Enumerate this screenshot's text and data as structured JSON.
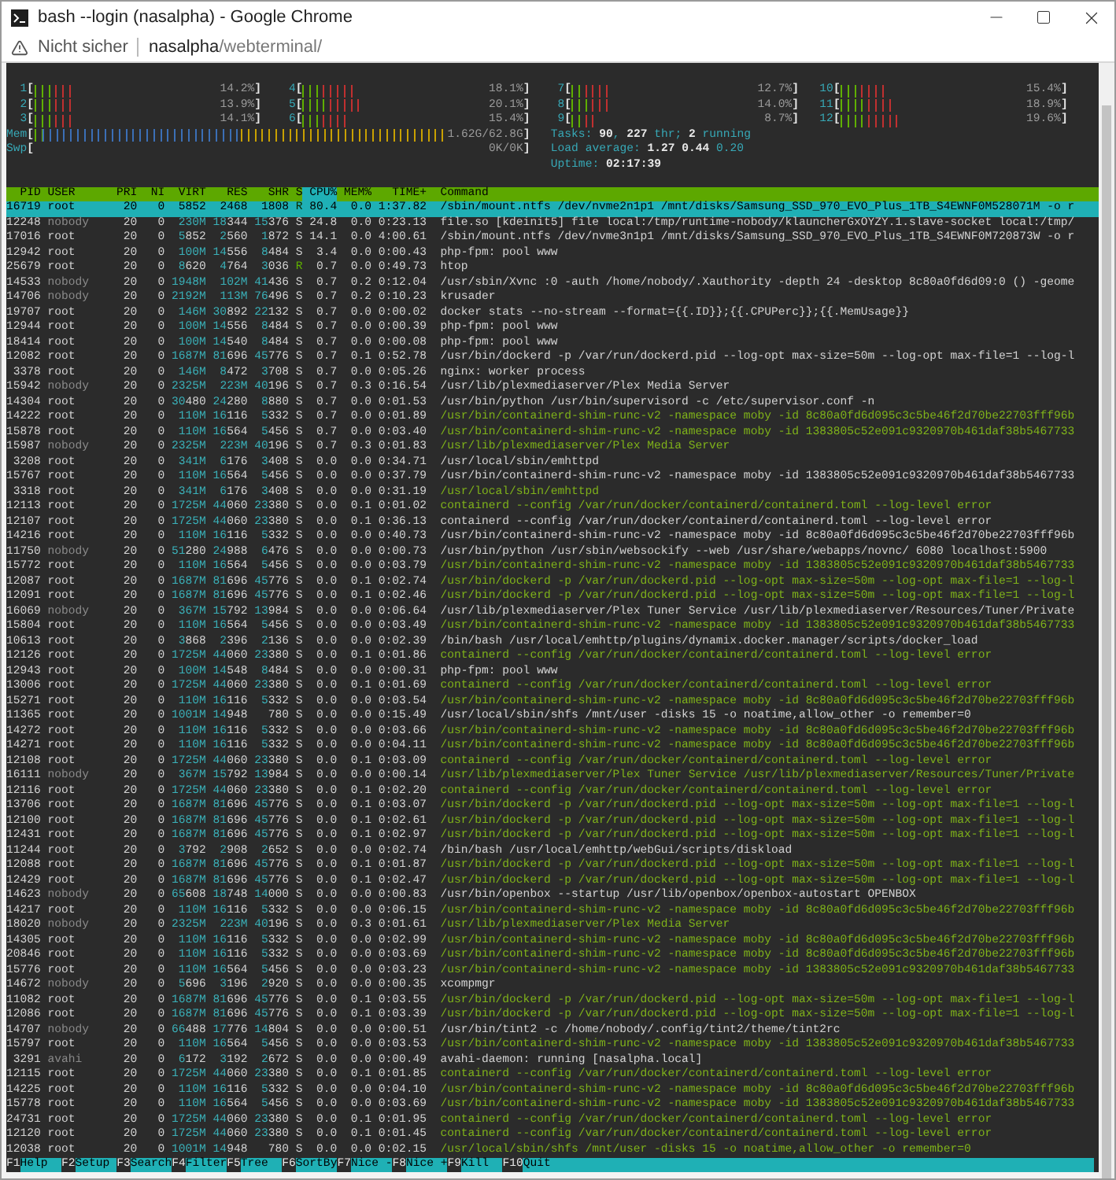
{
  "window": {
    "title": "bash --login (nasalpha) - Google Chrome"
  },
  "address_bar": {
    "security": "Nicht sicher",
    "host": "nasalpha",
    "path": "/webterminal/"
  },
  "meters": {
    "cpus": [
      {
        "label": "1",
        "open": "[",
        "reading": "14.2%",
        "close": "]"
      },
      {
        "label": "4",
        "open": "[",
        "reading": "18.1%",
        "close": "]"
      },
      {
        "label": "7",
        "open": "[",
        "reading": "12.7%",
        "close": "]"
      },
      {
        "label": "10",
        "open": "[",
        "reading": "15.4%",
        "close": "]"
      },
      {
        "label": "2",
        "open": "[",
        "reading": "13.9%",
        "close": "]"
      },
      {
        "label": "5",
        "open": "[",
        "reading": "20.1%",
        "close": "]"
      },
      {
        "label": "8",
        "open": "[",
        "reading": "14.0%",
        "close": "]"
      },
      {
        "label": "11",
        "open": "[",
        "reading": "18.9%",
        "close": "]"
      },
      {
        "label": "3",
        "open": "[",
        "reading": "14.1%",
        "close": "]"
      },
      {
        "label": "6",
        "open": "[",
        "reading": "15.4%",
        "close": "]"
      },
      {
        "label": "9",
        "open": "[",
        "reading": "8.7%",
        "close": "]"
      },
      {
        "label": "12",
        "open": "[",
        "reading": "19.6%",
        "close": "]"
      }
    ],
    "memory": [
      {
        "label": "Mem",
        "open": "[",
        "reading": "1.62G/62.8G",
        "close": "]",
        "filled": true
      },
      {
        "label": "Swp",
        "open": "[",
        "reading": "0K/0K",
        "close": "]",
        "filled": false
      }
    ],
    "info": [
      "Tasks: **90**, **227** thr; **2** running",
      "Load average: **1.27** **0.44** 0.20",
      "Uptime: **02:17:39**"
    ]
  },
  "table": {
    "columns": [
      {
        "label": "PID",
        "selected": false
      },
      {
        "label": "USER",
        "selected": false
      },
      {
        "label": "PRI",
        "selected": false
      },
      {
        "label": "NI",
        "selected": false
      },
      {
        "label": "VIRT",
        "selected": false
      },
      {
        "label": "RES",
        "selected": false
      },
      {
        "label": "SHR",
        "selected": false
      },
      {
        "label": "S",
        "selected": false
      },
      {
        "label": "CPU%",
        "selected": true
      },
      {
        "label": "MEM%",
        "selected": false
      },
      {
        "label": "TIME+",
        "selected": false
      },
      {
        "label": "Command",
        "selected": false
      }
    ],
    "rows": [
      {
        "pid": "16719",
        "user": "root",
        "pri": "20",
        "ni": "0",
        "virt": "5852",
        "res": "2468",
        "shr": "1808",
        "state": "R",
        "cpu": "80.4",
        "mem": "0.0",
        "time": "1:37.82",
        "command": "/sbin/mount.ntfs /dev/nvme2n1p1 /mnt/disks/Samsung_SSD_970_EVO_Plus_1TB_S4EWNF0M528071M -o r",
        "selected": true,
        "user_dimmed": false,
        "running": true,
        "thread": false
      },
      {
        "pid": "12248",
        "user": "nobody",
        "pri": "20",
        "ni": "0",
        "virt": "230M",
        "res": "18344",
        "shr": "15376",
        "state": "S",
        "cpu": "24.8",
        "mem": "0.0",
        "time": "0:23.13",
        "command": "file.so [kdeinit5] file local:/tmp/runtime-nobody/klauncherGxOYZY.1.slave-socket local:/tmp/",
        "selected": false,
        "user_dimmed": true,
        "running": false,
        "thread": false
      },
      {
        "pid": "17016",
        "user": "root",
        "pri": "20",
        "ni": "0",
        "virt": "5852",
        "res": "2560",
        "shr": "1872",
        "state": "S",
        "cpu": "14.1",
        "mem": "0.0",
        "time": "4:00.61",
        "command": "/sbin/mount.ntfs /dev/nvme3n1p1 /mnt/disks/Samsung_SSD_970_EVO_Plus_1TB_S4EWNF0M720873W -o r",
        "selected": false,
        "user_dimmed": false,
        "running": false,
        "thread": false
      },
      {
        "pid": "12942",
        "user": "root",
        "pri": "20",
        "ni": "0",
        "virt": "100M",
        "res": "14556",
        "shr": "8484",
        "state": "S",
        "cpu": "3.4",
        "mem": "0.0",
        "time": "0:00.43",
        "command": "php-fpm: pool www",
        "selected": false,
        "user_dimmed": false,
        "running": false,
        "thread": false
      },
      {
        "pid": "25679",
        "user": "root",
        "pri": "20",
        "ni": "0",
        "virt": "8620",
        "res": "4764",
        "shr": "3036",
        "state": "R",
        "cpu": "0.7",
        "mem": "0.0",
        "time": "0:49.73",
        "command": "htop",
        "selected": false,
        "user_dimmed": false,
        "running": true,
        "thread": false
      },
      {
        "pid": "14533",
        "user": "nobody",
        "pri": "20",
        "ni": "0",
        "virt": "1948M",
        "res": "102M",
        "shr": "41436",
        "state": "S",
        "cpu": "0.7",
        "mem": "0.2",
        "time": "0:12.04",
        "command": "/usr/sbin/Xvnc :0 -auth /home/nobody/.Xauthority -depth 24 -desktop 8c80a0fd6d09:0 () -geome",
        "selected": false,
        "user_dimmed": true,
        "running": false,
        "thread": false
      },
      {
        "pid": "14706",
        "user": "nobody",
        "pri": "20",
        "ni": "0",
        "virt": "2192M",
        "res": "113M",
        "shr": "76496",
        "state": "S",
        "cpu": "0.7",
        "mem": "0.2",
        "time": "0:10.23",
        "command": "krusader",
        "selected": false,
        "user_dimmed": true,
        "running": false,
        "thread": false
      },
      {
        "pid": "19707",
        "user": "root",
        "pri": "20",
        "ni": "0",
        "virt": "146M",
        "res": "30892",
        "shr": "22132",
        "state": "S",
        "cpu": "0.7",
        "mem": "0.0",
        "time": "0:00.02",
        "command": "docker stats --no-stream --format={{.ID}};{{.CPUPerc}};{{.MemUsage}}",
        "selected": false,
        "user_dimmed": false,
        "running": false,
        "thread": false
      },
      {
        "pid": "12944",
        "user": "root",
        "pri": "20",
        "ni": "0",
        "virt": "100M",
        "res": "14556",
        "shr": "8484",
        "state": "S",
        "cpu": "0.7",
        "mem": "0.0",
        "time": "0:00.39",
        "command": "php-fpm: pool www",
        "selected": false,
        "user_dimmed": false,
        "running": false,
        "thread": false
      },
      {
        "pid": "18414",
        "user": "root",
        "pri": "20",
        "ni": "0",
        "virt": "100M",
        "res": "14540",
        "shr": "8484",
        "state": "S",
        "cpu": "0.7",
        "mem": "0.0",
        "time": "0:00.08",
        "command": "php-fpm: pool www",
        "selected": false,
        "user_dimmed": false,
        "running": false,
        "thread": false
      },
      {
        "pid": "12082",
        "user": "root",
        "pri": "20",
        "ni": "0",
        "virt": "1687M",
        "res": "81696",
        "shr": "45776",
        "state": "S",
        "cpu": "0.7",
        "mem": "0.1",
        "time": "0:52.78",
        "command": "/usr/bin/dockerd -p /var/run/dockerd.pid --log-opt max-size=50m --log-opt max-file=1 --log-l",
        "selected": false,
        "user_dimmed": false,
        "running": false,
        "thread": false
      },
      {
        "pid": "3378",
        "user": "root",
        "pri": "20",
        "ni": "0",
        "virt": "146M",
        "res": "8472",
        "shr": "3708",
        "state": "S",
        "cpu": "0.7",
        "mem": "0.0",
        "time": "0:05.26",
        "command": "nginx: worker process",
        "selected": false,
        "user_dimmed": false,
        "running": false,
        "thread": false
      },
      {
        "pid": "15942",
        "user": "nobody",
        "pri": "20",
        "ni": "0",
        "virt": "2325M",
        "res": "223M",
        "shr": "40196",
        "state": "S",
        "cpu": "0.7",
        "mem": "0.3",
        "time": "0:16.54",
        "command": "/usr/lib/plexmediaserver/Plex Media Server",
        "selected": false,
        "user_dimmed": true,
        "running": false,
        "thread": false
      },
      {
        "pid": "14304",
        "user": "root",
        "pri": "20",
        "ni": "0",
        "virt": "30480",
        "res": "24280",
        "shr": "8880",
        "state": "S",
        "cpu": "0.7",
        "mem": "0.0",
        "time": "0:01.53",
        "command": "/usr/bin/python /usr/bin/supervisord -c /etc/supervisor.conf -n",
        "selected": false,
        "user_dimmed": false,
        "running": false,
        "thread": false
      },
      {
        "pid": "14222",
        "user": "root",
        "pri": "20",
        "ni": "0",
        "virt": "110M",
        "res": "16116",
        "shr": "5332",
        "state": "S",
        "cpu": "0.7",
        "mem": "0.0",
        "time": "0:01.89",
        "command": "/usr/bin/containerd-shim-runc-v2 -namespace moby -id 8c80a0fd6d095c3c5be46f2d70be22703fff96b",
        "selected": false,
        "user_dimmed": false,
        "running": false,
        "thread": true
      },
      {
        "pid": "15878",
        "user": "root",
        "pri": "20",
        "ni": "0",
        "virt": "110M",
        "res": "16564",
        "shr": "5456",
        "state": "S",
        "cpu": "0.7",
        "mem": "0.0",
        "time": "0:03.40",
        "command": "/usr/bin/containerd-shim-runc-v2 -namespace moby -id 1383805c52e091c9320970b461daf38b5467733",
        "selected": false,
        "user_dimmed": false,
        "running": false,
        "thread": true
      },
      {
        "pid": "15987",
        "user": "nobody",
        "pri": "20",
        "ni": "0",
        "virt": "2325M",
        "res": "223M",
        "shr": "40196",
        "state": "S",
        "cpu": "0.7",
        "mem": "0.3",
        "time": "0:01.83",
        "command": "/usr/lib/plexmediaserver/Plex Media Server",
        "selected": false,
        "user_dimmed": true,
        "running": false,
        "thread": true
      },
      {
        "pid": "3208",
        "user": "root",
        "pri": "20",
        "ni": "0",
        "virt": "341M",
        "res": "6176",
        "shr": "3408",
        "state": "S",
        "cpu": "0.0",
        "mem": "0.0",
        "time": "0:34.71",
        "command": "/usr/local/sbin/emhttpd",
        "selected": false,
        "user_dimmed": false,
        "running": false,
        "thread": false
      },
      {
        "pid": "15767",
        "user": "root",
        "pri": "20",
        "ni": "0",
        "virt": "110M",
        "res": "16564",
        "shr": "5456",
        "state": "S",
        "cpu": "0.0",
        "mem": "0.0",
        "time": "0:37.79",
        "command": "/usr/bin/containerd-shim-runc-v2 -namespace moby -id 1383805c52e091c9320970b461daf38b5467733",
        "selected": false,
        "user_dimmed": false,
        "running": false,
        "thread": false
      },
      {
        "pid": "3318",
        "user": "root",
        "pri": "20",
        "ni": "0",
        "virt": "341M",
        "res": "6176",
        "shr": "3408",
        "state": "S",
        "cpu": "0.0",
        "mem": "0.0",
        "time": "0:31.19",
        "command": "/usr/local/sbin/emhttpd",
        "selected": false,
        "user_dimmed": false,
        "running": false,
        "thread": true
      },
      {
        "pid": "12113",
        "user": "root",
        "pri": "20",
        "ni": "0",
        "virt": "1725M",
        "res": "44060",
        "shr": "23380",
        "state": "S",
        "cpu": "0.0",
        "mem": "0.1",
        "time": "0:01.02",
        "command": "containerd --config /var/run/docker/containerd/containerd.toml --log-level error",
        "selected": false,
        "user_dimmed": false,
        "running": false,
        "thread": true
      },
      {
        "pid": "12107",
        "user": "root",
        "pri": "20",
        "ni": "0",
        "virt": "1725M",
        "res": "44060",
        "shr": "23380",
        "state": "S",
        "cpu": "0.0",
        "mem": "0.1",
        "time": "0:36.13",
        "command": "containerd --config /var/run/docker/containerd/containerd.toml --log-level error",
        "selected": false,
        "user_dimmed": false,
        "running": false,
        "thread": false
      },
      {
        "pid": "14216",
        "user": "root",
        "pri": "20",
        "ni": "0",
        "virt": "110M",
        "res": "16116",
        "shr": "5332",
        "state": "S",
        "cpu": "0.0",
        "mem": "0.0",
        "time": "0:40.73",
        "command": "/usr/bin/containerd-shim-runc-v2 -namespace moby -id 8c80a0fd6d095c3c5be46f2d70be22703fff96b",
        "selected": false,
        "user_dimmed": false,
        "running": false,
        "thread": false
      },
      {
        "pid": "11750",
        "user": "nobody",
        "pri": "20",
        "ni": "0",
        "virt": "51280",
        "res": "24988",
        "shr": "6476",
        "state": "S",
        "cpu": "0.0",
        "mem": "0.0",
        "time": "0:00.73",
        "command": "/usr/bin/python /usr/sbin/websockify --web /usr/share/webapps/novnc/ 6080 localhost:5900",
        "selected": false,
        "user_dimmed": true,
        "running": false,
        "thread": false
      },
      {
        "pid": "15772",
        "user": "root",
        "pri": "20",
        "ni": "0",
        "virt": "110M",
        "res": "16564",
        "shr": "5456",
        "state": "S",
        "cpu": "0.0",
        "mem": "0.0",
        "time": "0:03.79",
        "command": "/usr/bin/containerd-shim-runc-v2 -namespace moby -id 1383805c52e091c9320970b461daf38b5467733",
        "selected": false,
        "user_dimmed": false,
        "running": false,
        "thread": true
      },
      {
        "pid": "12087",
        "user": "root",
        "pri": "20",
        "ni": "0",
        "virt": "1687M",
        "res": "81696",
        "shr": "45776",
        "state": "S",
        "cpu": "0.0",
        "mem": "0.1",
        "time": "0:02.74",
        "command": "/usr/bin/dockerd -p /var/run/dockerd.pid --log-opt max-size=50m --log-opt max-file=1 --log-l",
        "selected": false,
        "user_dimmed": false,
        "running": false,
        "thread": true
      },
      {
        "pid": "12091",
        "user": "root",
        "pri": "20",
        "ni": "0",
        "virt": "1687M",
        "res": "81696",
        "shr": "45776",
        "state": "S",
        "cpu": "0.0",
        "mem": "0.1",
        "time": "0:02.46",
        "command": "/usr/bin/dockerd -p /var/run/dockerd.pid --log-opt max-size=50m --log-opt max-file=1 --log-l",
        "selected": false,
        "user_dimmed": false,
        "running": false,
        "thread": true
      },
      {
        "pid": "16069",
        "user": "nobody",
        "pri": "20",
        "ni": "0",
        "virt": "367M",
        "res": "15792",
        "shr": "13984",
        "state": "S",
        "cpu": "0.0",
        "mem": "0.0",
        "time": "0:06.64",
        "command": "/usr/lib/plexmediaserver/Plex Tuner Service /usr/lib/plexmediaserver/Resources/Tuner/Private",
        "selected": false,
        "user_dimmed": true,
        "running": false,
        "thread": false
      },
      {
        "pid": "15804",
        "user": "root",
        "pri": "20",
        "ni": "0",
        "virt": "110M",
        "res": "16564",
        "shr": "5456",
        "state": "S",
        "cpu": "0.0",
        "mem": "0.0",
        "time": "0:03.49",
        "command": "/usr/bin/containerd-shim-runc-v2 -namespace moby -id 1383805c52e091c9320970b461daf38b5467733",
        "selected": false,
        "user_dimmed": false,
        "running": false,
        "thread": true
      },
      {
        "pid": "10613",
        "user": "root",
        "pri": "20",
        "ni": "0",
        "virt": "3868",
        "res": "2396",
        "shr": "2136",
        "state": "S",
        "cpu": "0.0",
        "mem": "0.0",
        "time": "0:02.39",
        "command": "/bin/bash /usr/local/emhttp/plugins/dynamix.docker.manager/scripts/docker_load",
        "selected": false,
        "user_dimmed": false,
        "running": false,
        "thread": false
      },
      {
        "pid": "12126",
        "user": "root",
        "pri": "20",
        "ni": "0",
        "virt": "1725M",
        "res": "44060",
        "shr": "23380",
        "state": "S",
        "cpu": "0.0",
        "mem": "0.1",
        "time": "0:01.86",
        "command": "containerd --config /var/run/docker/containerd/containerd.toml --log-level error",
        "selected": false,
        "user_dimmed": false,
        "running": false,
        "thread": true
      },
      {
        "pid": "12943",
        "user": "root",
        "pri": "20",
        "ni": "0",
        "virt": "100M",
        "res": "14548",
        "shr": "8484",
        "state": "S",
        "cpu": "0.0",
        "mem": "0.0",
        "time": "0:00.31",
        "command": "php-fpm: pool www",
        "selected": false,
        "user_dimmed": false,
        "running": false,
        "thread": false
      },
      {
        "pid": "13006",
        "user": "root",
        "pri": "20",
        "ni": "0",
        "virt": "1725M",
        "res": "44060",
        "shr": "23380",
        "state": "S",
        "cpu": "0.0",
        "mem": "0.1",
        "time": "0:01.69",
        "command": "containerd --config /var/run/docker/containerd/containerd.toml --log-level error",
        "selected": false,
        "user_dimmed": false,
        "running": false,
        "thread": true
      },
      {
        "pid": "15271",
        "user": "root",
        "pri": "20",
        "ni": "0",
        "virt": "110M",
        "res": "16116",
        "shr": "5332",
        "state": "S",
        "cpu": "0.0",
        "mem": "0.0",
        "time": "0:03.54",
        "command": "/usr/bin/containerd-shim-runc-v2 -namespace moby -id 8c80a0fd6d095c3c5be46f2d70be22703fff96b",
        "selected": false,
        "user_dimmed": false,
        "running": false,
        "thread": true
      },
      {
        "pid": "11365",
        "user": "root",
        "pri": "20",
        "ni": "0",
        "virt": "1001M",
        "res": "14948",
        "shr": "780",
        "state": "S",
        "cpu": "0.0",
        "mem": "0.0",
        "time": "0:15.49",
        "command": "/usr/local/sbin/shfs /mnt/user -disks 15 -o noatime,allow_other -o remember=0",
        "selected": false,
        "user_dimmed": false,
        "running": false,
        "thread": false
      },
      {
        "pid": "14272",
        "user": "root",
        "pri": "20",
        "ni": "0",
        "virt": "110M",
        "res": "16116",
        "shr": "5332",
        "state": "S",
        "cpu": "0.0",
        "mem": "0.0",
        "time": "0:03.66",
        "command": "/usr/bin/containerd-shim-runc-v2 -namespace moby -id 8c80a0fd6d095c3c5be46f2d70be22703fff96b",
        "selected": false,
        "user_dimmed": false,
        "running": false,
        "thread": true
      },
      {
        "pid": "14271",
        "user": "root",
        "pri": "20",
        "ni": "0",
        "virt": "110M",
        "res": "16116",
        "shr": "5332",
        "state": "S",
        "cpu": "0.0",
        "mem": "0.0",
        "time": "0:04.11",
        "command": "/usr/bin/containerd-shim-runc-v2 -namespace moby -id 8c80a0fd6d095c3c5be46f2d70be22703fff96b",
        "selected": false,
        "user_dimmed": false,
        "running": false,
        "thread": true
      },
      {
        "pid": "12108",
        "user": "root",
        "pri": "20",
        "ni": "0",
        "virt": "1725M",
        "res": "44060",
        "shr": "23380",
        "state": "S",
        "cpu": "0.0",
        "mem": "0.1",
        "time": "0:03.09",
        "command": "containerd --config /var/run/docker/containerd/containerd.toml --log-level error",
        "selected": false,
        "user_dimmed": false,
        "running": false,
        "thread": true
      },
      {
        "pid": "16111",
        "user": "nobody",
        "pri": "20",
        "ni": "0",
        "virt": "367M",
        "res": "15792",
        "shr": "13984",
        "state": "S",
        "cpu": "0.0",
        "mem": "0.0",
        "time": "0:00.14",
        "command": "/usr/lib/plexmediaserver/Plex Tuner Service /usr/lib/plexmediaserver/Resources/Tuner/Private",
        "selected": false,
        "user_dimmed": true,
        "running": false,
        "thread": true
      },
      {
        "pid": "12116",
        "user": "root",
        "pri": "20",
        "ni": "0",
        "virt": "1725M",
        "res": "44060",
        "shr": "23380",
        "state": "S",
        "cpu": "0.0",
        "mem": "0.1",
        "time": "0:02.20",
        "command": "containerd --config /var/run/docker/containerd/containerd.toml --log-level error",
        "selected": false,
        "user_dimmed": false,
        "running": false,
        "thread": true
      },
      {
        "pid": "13706",
        "user": "root",
        "pri": "20",
        "ni": "0",
        "virt": "1687M",
        "res": "81696",
        "shr": "45776",
        "state": "S",
        "cpu": "0.0",
        "mem": "0.1",
        "time": "0:03.07",
        "command": "/usr/bin/dockerd -p /var/run/dockerd.pid --log-opt max-size=50m --log-opt max-file=1 --log-l",
        "selected": false,
        "user_dimmed": false,
        "running": false,
        "thread": true
      },
      {
        "pid": "12100",
        "user": "root",
        "pri": "20",
        "ni": "0",
        "virt": "1687M",
        "res": "81696",
        "shr": "45776",
        "state": "S",
        "cpu": "0.0",
        "mem": "0.1",
        "time": "0:02.61",
        "command": "/usr/bin/dockerd -p /var/run/dockerd.pid --log-opt max-size=50m --log-opt max-file=1 --log-l",
        "selected": false,
        "user_dimmed": false,
        "running": false,
        "thread": true
      },
      {
        "pid": "12431",
        "user": "root",
        "pri": "20",
        "ni": "0",
        "virt": "1687M",
        "res": "81696",
        "shr": "45776",
        "state": "S",
        "cpu": "0.0",
        "mem": "0.1",
        "time": "0:02.97",
        "command": "/usr/bin/dockerd -p /var/run/dockerd.pid --log-opt max-size=50m --log-opt max-file=1 --log-l",
        "selected": false,
        "user_dimmed": false,
        "running": false,
        "thread": true
      },
      {
        "pid": "11244",
        "user": "root",
        "pri": "20",
        "ni": "0",
        "virt": "3792",
        "res": "2908",
        "shr": "2652",
        "state": "S",
        "cpu": "0.0",
        "mem": "0.0",
        "time": "0:02.74",
        "command": "/bin/bash /usr/local/emhttp/webGui/scripts/diskload",
        "selected": false,
        "user_dimmed": false,
        "running": false,
        "thread": false
      },
      {
        "pid": "12088",
        "user": "root",
        "pri": "20",
        "ni": "0",
        "virt": "1687M",
        "res": "81696",
        "shr": "45776",
        "state": "S",
        "cpu": "0.0",
        "mem": "0.1",
        "time": "0:01.87",
        "command": "/usr/bin/dockerd -p /var/run/dockerd.pid --log-opt max-size=50m --log-opt max-file=1 --log-l",
        "selected": false,
        "user_dimmed": false,
        "running": false,
        "thread": true
      },
      {
        "pid": "12429",
        "user": "root",
        "pri": "20",
        "ni": "0",
        "virt": "1687M",
        "res": "81696",
        "shr": "45776",
        "state": "S",
        "cpu": "0.0",
        "mem": "0.1",
        "time": "0:02.47",
        "command": "/usr/bin/dockerd -p /var/run/dockerd.pid --log-opt max-size=50m --log-opt max-file=1 --log-l",
        "selected": false,
        "user_dimmed": false,
        "running": false,
        "thread": true
      },
      {
        "pid": "14623",
        "user": "nobody",
        "pri": "20",
        "ni": "0",
        "virt": "65608",
        "res": "18748",
        "shr": "14000",
        "state": "S",
        "cpu": "0.0",
        "mem": "0.0",
        "time": "0:00.83",
        "command": "/usr/bin/openbox --startup /usr/lib/openbox/openbox-autostart OPENBOX",
        "selected": false,
        "user_dimmed": true,
        "running": false,
        "thread": false
      },
      {
        "pid": "14217",
        "user": "root",
        "pri": "20",
        "ni": "0",
        "virt": "110M",
        "res": "16116",
        "shr": "5332",
        "state": "S",
        "cpu": "0.0",
        "mem": "0.0",
        "time": "0:06.15",
        "command": "/usr/bin/containerd-shim-runc-v2 -namespace moby -id 8c80a0fd6d095c3c5be46f2d70be22703fff96b",
        "selected": false,
        "user_dimmed": false,
        "running": false,
        "thread": true
      },
      {
        "pid": "18020",
        "user": "nobody",
        "pri": "20",
        "ni": "0",
        "virt": "2325M",
        "res": "223M",
        "shr": "40196",
        "state": "S",
        "cpu": "0.0",
        "mem": "0.3",
        "time": "0:01.61",
        "command": "/usr/lib/plexmediaserver/Plex Media Server",
        "selected": false,
        "user_dimmed": true,
        "running": false,
        "thread": true
      },
      {
        "pid": "14305",
        "user": "root",
        "pri": "20",
        "ni": "0",
        "virt": "110M",
        "res": "16116",
        "shr": "5332",
        "state": "S",
        "cpu": "0.0",
        "mem": "0.0",
        "time": "0:02.99",
        "command": "/usr/bin/containerd-shim-runc-v2 -namespace moby -id 8c80a0fd6d095c3c5be46f2d70be22703fff96b",
        "selected": false,
        "user_dimmed": false,
        "running": false,
        "thread": true
      },
      {
        "pid": "20846",
        "user": "root",
        "pri": "20",
        "ni": "0",
        "virt": "110M",
        "res": "16116",
        "shr": "5332",
        "state": "S",
        "cpu": "0.0",
        "mem": "0.0",
        "time": "0:03.69",
        "command": "/usr/bin/containerd-shim-runc-v2 -namespace moby -id 8c80a0fd6d095c3c5be46f2d70be22703fff96b",
        "selected": false,
        "user_dimmed": false,
        "running": false,
        "thread": true
      },
      {
        "pid": "15776",
        "user": "root",
        "pri": "20",
        "ni": "0",
        "virt": "110M",
        "res": "16564",
        "shr": "5456",
        "state": "S",
        "cpu": "0.0",
        "mem": "0.0",
        "time": "0:03.23",
        "command": "/usr/bin/containerd-shim-runc-v2 -namespace moby -id 1383805c52e091c9320970b461daf38b5467733",
        "selected": false,
        "user_dimmed": false,
        "running": false,
        "thread": true
      },
      {
        "pid": "14672",
        "user": "nobody",
        "pri": "20",
        "ni": "0",
        "virt": "5696",
        "res": "3196",
        "shr": "2920",
        "state": "S",
        "cpu": "0.0",
        "mem": "0.0",
        "time": "0:00.35",
        "command": "xcompmgr",
        "selected": false,
        "user_dimmed": true,
        "running": false,
        "thread": false
      },
      {
        "pid": "11082",
        "user": "root",
        "pri": "20",
        "ni": "0",
        "virt": "1687M",
        "res": "81696",
        "shr": "45776",
        "state": "S",
        "cpu": "0.0",
        "mem": "0.1",
        "time": "0:03.55",
        "command": "/usr/bin/dockerd -p /var/run/dockerd.pid --log-opt max-size=50m --log-opt max-file=1 --log-l",
        "selected": false,
        "user_dimmed": false,
        "running": false,
        "thread": true
      },
      {
        "pid": "12086",
        "user": "root",
        "pri": "20",
        "ni": "0",
        "virt": "1687M",
        "res": "81696",
        "shr": "45776",
        "state": "S",
        "cpu": "0.0",
        "mem": "0.1",
        "time": "0:03.39",
        "command": "/usr/bin/dockerd -p /var/run/dockerd.pid --log-opt max-size=50m --log-opt max-file=1 --log-l",
        "selected": false,
        "user_dimmed": false,
        "running": false,
        "thread": true
      },
      {
        "pid": "14707",
        "user": "nobody",
        "pri": "20",
        "ni": "0",
        "virt": "66488",
        "res": "17776",
        "shr": "14804",
        "state": "S",
        "cpu": "0.0",
        "mem": "0.0",
        "time": "0:00.51",
        "command": "/usr/bin/tint2 -c /home/nobody/.config/tint2/theme/tint2rc",
        "selected": false,
        "user_dimmed": true,
        "running": false,
        "thread": false
      },
      {
        "pid": "15797",
        "user": "root",
        "pri": "20",
        "ni": "0",
        "virt": "110M",
        "res": "16564",
        "shr": "5456",
        "state": "S",
        "cpu": "0.0",
        "mem": "0.0",
        "time": "0:03.53",
        "command": "/usr/bin/containerd-shim-runc-v2 -namespace moby -id 1383805c52e091c9320970b461daf38b5467733",
        "selected": false,
        "user_dimmed": false,
        "running": false,
        "thread": true
      },
      {
        "pid": "3291",
        "user": "avahi",
        "pri": "20",
        "ni": "0",
        "virt": "6172",
        "res": "3192",
        "shr": "2672",
        "state": "S",
        "cpu": "0.0",
        "mem": "0.0",
        "time": "0:00.49",
        "command": "avahi-daemon: running [nasalpha.local]",
        "selected": false,
        "user_dimmed": true,
        "running": false,
        "thread": false
      },
      {
        "pid": "12115",
        "user": "root",
        "pri": "20",
        "ni": "0",
        "virt": "1725M",
        "res": "44060",
        "shr": "23380",
        "state": "S",
        "cpu": "0.0",
        "mem": "0.1",
        "time": "0:01.85",
        "command": "containerd --config /var/run/docker/containerd/containerd.toml --log-level error",
        "selected": false,
        "user_dimmed": false,
        "running": false,
        "thread": true
      },
      {
        "pid": "14225",
        "user": "root",
        "pri": "20",
        "ni": "0",
        "virt": "110M",
        "res": "16116",
        "shr": "5332",
        "state": "S",
        "cpu": "0.0",
        "mem": "0.0",
        "time": "0:04.10",
        "command": "/usr/bin/containerd-shim-runc-v2 -namespace moby -id 8c80a0fd6d095c3c5be46f2d70be22703fff96b",
        "selected": false,
        "user_dimmed": false,
        "running": false,
        "thread": true
      },
      {
        "pid": "15778",
        "user": "root",
        "pri": "20",
        "ni": "0",
        "virt": "110M",
        "res": "16564",
        "shr": "5456",
        "state": "S",
        "cpu": "0.0",
        "mem": "0.0",
        "time": "0:03.69",
        "command": "/usr/bin/containerd-shim-runc-v2 -namespace moby -id 1383805c52e091c9320970b461daf38b5467733",
        "selected": false,
        "user_dimmed": false,
        "running": false,
        "thread": true
      },
      {
        "pid": "24731",
        "user": "root",
        "pri": "20",
        "ni": "0",
        "virt": "1725M",
        "res": "44060",
        "shr": "23380",
        "state": "S",
        "cpu": "0.0",
        "mem": "0.1",
        "time": "0:01.95",
        "command": "containerd --config /var/run/docker/containerd/containerd.toml --log-level error",
        "selected": false,
        "user_dimmed": false,
        "running": false,
        "thread": true
      },
      {
        "pid": "12120",
        "user": "root",
        "pri": "20",
        "ni": "0",
        "virt": "1725M",
        "res": "44060",
        "shr": "23380",
        "state": "S",
        "cpu": "0.0",
        "mem": "0.1",
        "time": "0:01.45",
        "command": "containerd --config /var/run/docker/containerd/containerd.toml --log-level error",
        "selected": false,
        "user_dimmed": false,
        "running": false,
        "thread": true
      },
      {
        "pid": "12038",
        "user": "root",
        "pri": "20",
        "ni": "0",
        "virt": "1001M",
        "res": "14948",
        "shr": "780",
        "state": "S",
        "cpu": "0.0",
        "mem": "0.0",
        "time": "0:02.15",
        "command": "/usr/local/sbin/shfs /mnt/user -disks 15 -o noatime,allow_other -o remember=0",
        "selected": false,
        "user_dimmed": false,
        "running": false,
        "thread": true
      }
    ]
  },
  "function_keys": [
    {
      "key": "F1",
      "label": "Help"
    },
    {
      "key": "F2",
      "label": "Setup"
    },
    {
      "key": "F3",
      "label": "Search"
    },
    {
      "key": "F4",
      "label": "Filter"
    },
    {
      "key": "F5",
      "label": "Tree"
    },
    {
      "key": "F6",
      "label": "SortBy"
    },
    {
      "key": "F7",
      "label": "Nice -"
    },
    {
      "key": "F8",
      "label": "Nice +"
    },
    {
      "key": "F9",
      "label": "Kill"
    },
    {
      "key": "F10",
      "label": "Quit"
    }
  ]
}
